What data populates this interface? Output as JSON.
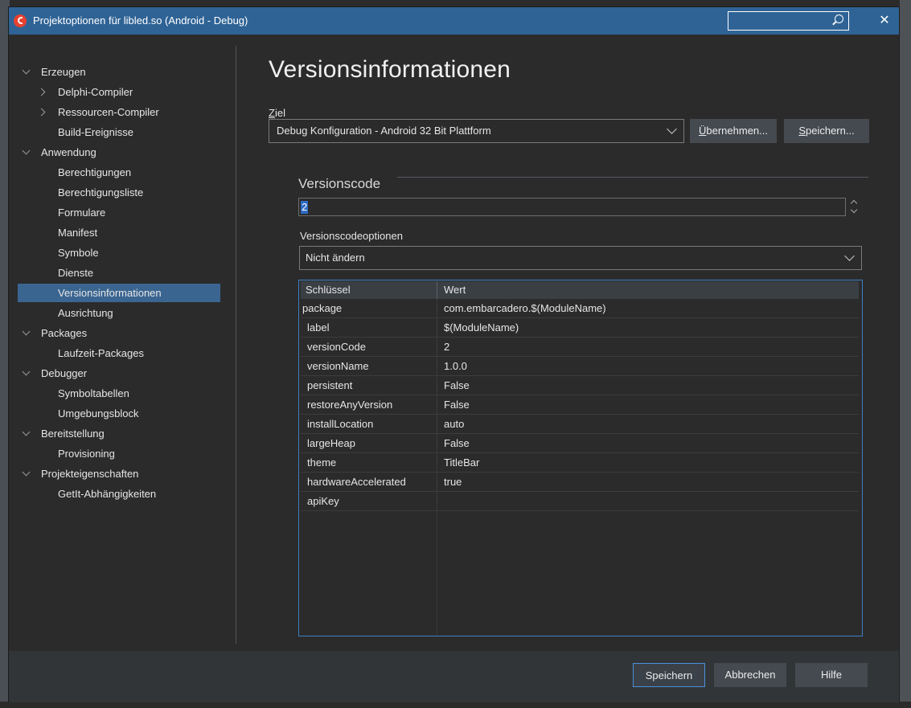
{
  "window": {
    "title": "Projektoptionen für libled.so  (Android - Debug)",
    "search_value": "",
    "close_label": "✕"
  },
  "sidebar": {
    "items": [
      {
        "label": "Erzeugen",
        "level": 0,
        "expander": "expanded"
      },
      {
        "label": "Delphi-Compiler",
        "level": 1,
        "expander": "collapsed"
      },
      {
        "label": "Ressourcen-Compiler",
        "level": 1,
        "expander": "collapsed"
      },
      {
        "label": "Build-Ereignisse",
        "level": 1,
        "expander": "none"
      },
      {
        "label": "Anwendung",
        "level": 0,
        "expander": "expanded"
      },
      {
        "label": "Berechtigungen",
        "level": 1,
        "expander": "none"
      },
      {
        "label": "Berechtigungsliste",
        "level": 1,
        "expander": "none"
      },
      {
        "label": "Formulare",
        "level": 1,
        "expander": "none"
      },
      {
        "label": "Manifest",
        "level": 1,
        "expander": "none"
      },
      {
        "label": "Symbole",
        "level": 1,
        "expander": "none"
      },
      {
        "label": "Dienste",
        "level": 1,
        "expander": "none"
      },
      {
        "label": "Versionsinformationen",
        "level": 1,
        "expander": "none",
        "selected": true
      },
      {
        "label": "Ausrichtung",
        "level": 1,
        "expander": "none"
      },
      {
        "label": "Packages",
        "level": 0,
        "expander": "expanded"
      },
      {
        "label": "Laufzeit-Packages",
        "level": 1,
        "expander": "none"
      },
      {
        "label": "Debugger",
        "level": 0,
        "expander": "expanded"
      },
      {
        "label": "Symboltabellen",
        "level": 1,
        "expander": "none"
      },
      {
        "label": "Umgebungsblock",
        "level": 1,
        "expander": "none"
      },
      {
        "label": "Bereitstellung",
        "level": 0,
        "expander": "expanded"
      },
      {
        "label": "Provisioning",
        "level": 1,
        "expander": "none"
      },
      {
        "label": "Projekteigenschaften",
        "level": 0,
        "expander": "expanded"
      },
      {
        "label": "GetIt-Abhängigkeiten",
        "level": 1,
        "expander": "none"
      }
    ]
  },
  "main": {
    "page_title": "Versionsinformationen",
    "target_label_mnemonic": "Z",
    "target_label_rest": "iel",
    "target_value": "Debug Konfiguration - Android 32 Bit Plattform",
    "apply_button": {
      "mnemonic": "Ü",
      "rest": "bernehmen..."
    },
    "save_as_button": {
      "mnemonic": "S",
      "rest": "peichern..."
    },
    "version_code_group": "Versionscode",
    "version_code_value": "2",
    "version_code_options_label": "Versionscodeoptionen",
    "version_code_option_value": "Nicht ändern",
    "table": {
      "columns": [
        "Schlüssel",
        "Wert"
      ],
      "rows": [
        {
          "key": "package",
          "value": "com.embarcadero.$(ModuleName)"
        },
        {
          "key": "label",
          "value": "$(ModuleName)"
        },
        {
          "key": "versionCode",
          "value": "2"
        },
        {
          "key": "versionName",
          "value": "1.0.0"
        },
        {
          "key": "persistent",
          "value": "False"
        },
        {
          "key": "restoreAnyVersion",
          "value": "False"
        },
        {
          "key": "installLocation",
          "value": "auto"
        },
        {
          "key": "largeHeap",
          "value": "False"
        },
        {
          "key": "theme",
          "value": "TitleBar"
        },
        {
          "key": "hardwareAccelerated",
          "value": "true"
        },
        {
          "key": "apiKey",
          "value": ""
        }
      ]
    }
  },
  "footer": {
    "save_label": "Speichern",
    "cancel_label": "Abbrechen",
    "help_label": "Hilfe"
  },
  "colors": {
    "titlebar": "#2f6395",
    "selection": "#3a6591",
    "grid_border": "#3d7fc4",
    "background": "#2b2b2b"
  }
}
